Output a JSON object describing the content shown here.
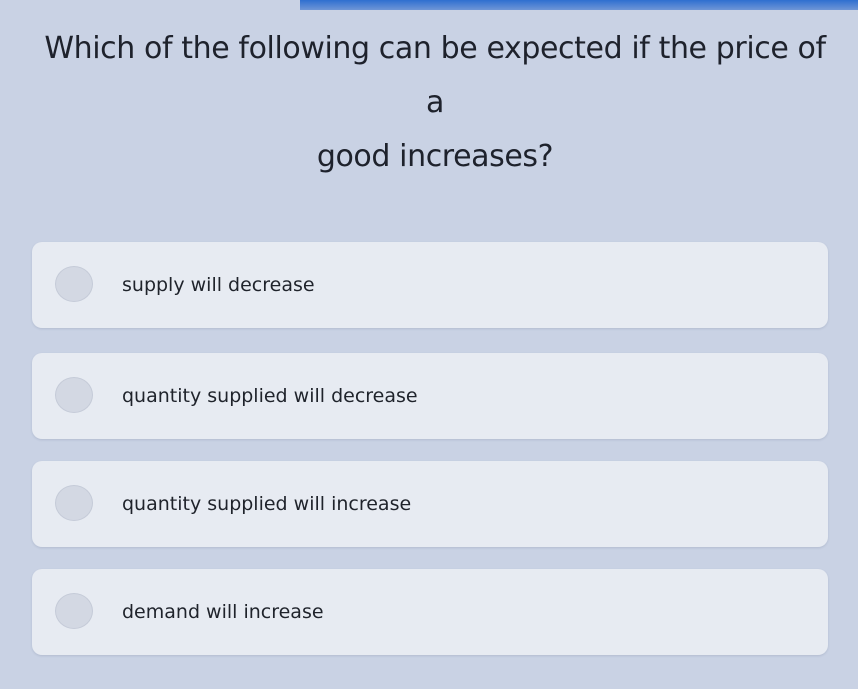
{
  "question": {
    "line1": "Which of the following can be expected if the price of a",
    "line2": "good increases?"
  },
  "options": [
    {
      "label": "supply will decrease"
    },
    {
      "label": "quantity supplied will decrease"
    },
    {
      "label": "quantity supplied will increase"
    },
    {
      "label": "demand will increase"
    }
  ],
  "colors": {
    "background": "#c9d2e4",
    "option_card": "#e7ebf2",
    "accent_bar": "#2f6fd0",
    "text": "#1e222c"
  }
}
